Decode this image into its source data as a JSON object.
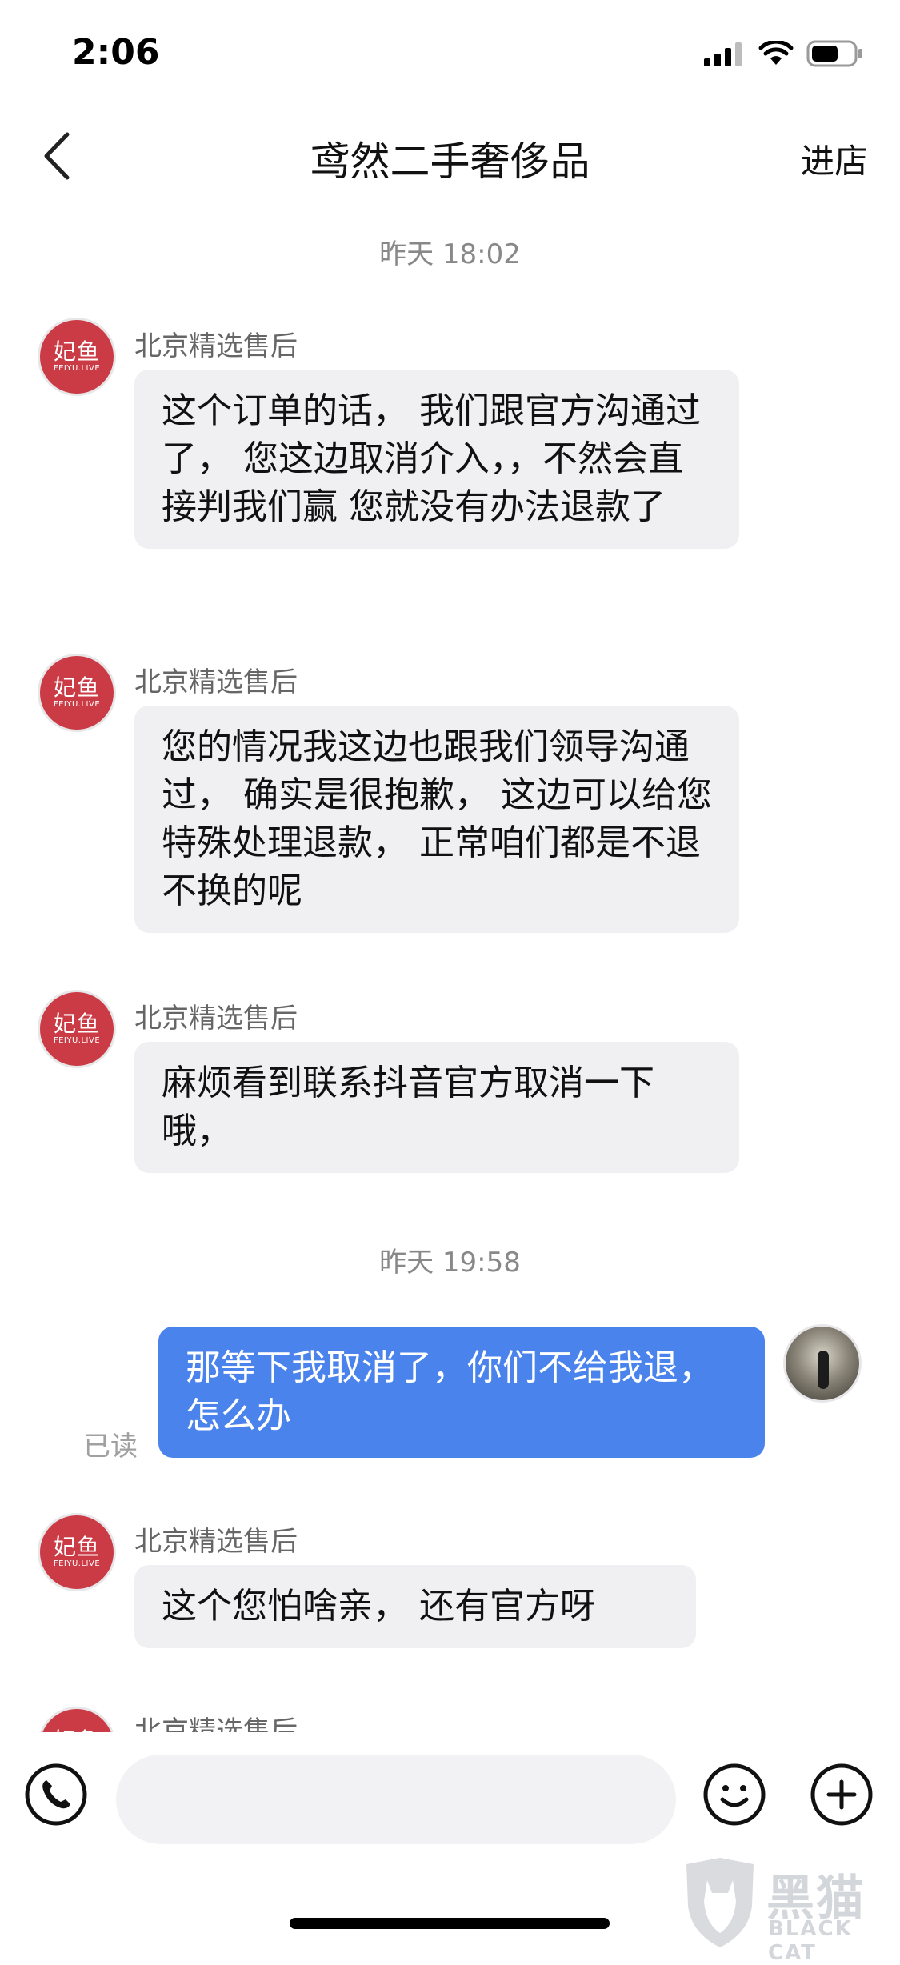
{
  "status_bar": {
    "time": "2:06",
    "icons": [
      "cellular-signal-icon",
      "wifi-icon",
      "battery-icon"
    ]
  },
  "header": {
    "title": "鸢然二手奢侈品",
    "action_label": "进店",
    "back_icon": "chevron-left-icon"
  },
  "colors": {
    "my_bubble": "#4a83ec",
    "their_bubble": "#f0f0f3",
    "avatar_brand": "#cb3b46"
  },
  "avatar_logo": {
    "cn": "妃鱼",
    "en": "FEIYU.LIVE"
  },
  "timestamps": [
    "昨天 18:02",
    "昨天 19:58"
  ],
  "messages": [
    {
      "sender": "北京精选售后",
      "text": "这个订单的话， 我们跟官方沟通过了， 您这边取消介入，，不然会直接判我们赢  您就没有办法退款了"
    },
    {
      "sender": "北京精选售后",
      "text": "您的情况我这边也跟我们领导沟通过， 确实是很抱歉， 这边可以给您特殊处理退款， 正常咱们都是不退不换的呢"
    },
    {
      "sender": "北京精选售后",
      "text": "麻烦看到联系抖音官方取消一下哦，"
    },
    {
      "sender": "me",
      "text": "那等下我取消了，你们不给我退，怎么办",
      "read_label": "已读"
    },
    {
      "sender": "北京精选售后",
      "text": "这个您怕啥亲， 还有官方呀"
    },
    {
      "sender": "北京精选售后",
      "text": ""
    }
  ],
  "input_bar": {
    "placeholder": "",
    "icons": [
      "phone-icon",
      "emoji-icon",
      "plus-icon"
    ]
  },
  "watermark": {
    "cn": "黑猫",
    "en": "BLACK CAT"
  }
}
